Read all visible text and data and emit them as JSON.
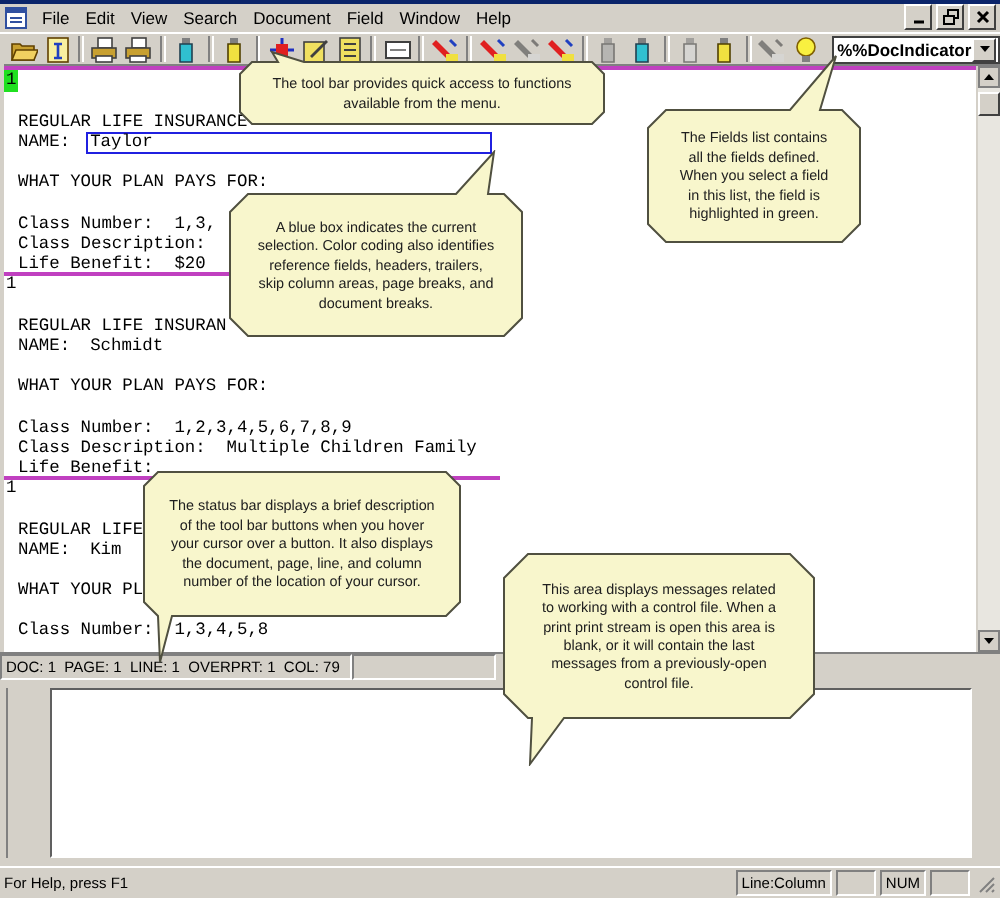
{
  "menu": [
    "File",
    "Edit",
    "View",
    "Search",
    "Document",
    "Field",
    "Window",
    "Help"
  ],
  "toolbar": {
    "buttons": [
      {
        "kind": "folder",
        "disabled": false,
        "separator_before": false
      },
      {
        "kind": "document",
        "disabled": false,
        "separator_before": false
      },
      {
        "kind": "printer",
        "disabled": false,
        "separator_before": true
      },
      {
        "kind": "printer",
        "disabled": false,
        "separator_before": false
      },
      {
        "kind": "flask",
        "disabled": false,
        "separator_before": true
      },
      {
        "kind": "jar",
        "disabled": false,
        "separator_before": true
      },
      {
        "kind": "target",
        "disabled": false,
        "separator_before": true
      },
      {
        "kind": "edit",
        "disabled": false,
        "separator_before": false
      },
      {
        "kind": "list",
        "disabled": false,
        "separator_before": false
      },
      {
        "kind": "box",
        "disabled": false,
        "separator_before": true
      },
      {
        "kind": "marker",
        "disabled": false,
        "separator_before": true
      },
      {
        "kind": "marker",
        "disabled": false,
        "separator_before": true
      },
      {
        "kind": "marker",
        "disabled": true,
        "separator_before": false
      },
      {
        "kind": "marker",
        "disabled": false,
        "separator_before": false
      },
      {
        "kind": "flask",
        "disabled": true,
        "separator_before": true
      },
      {
        "kind": "flask",
        "disabled": false,
        "separator_before": false
      },
      {
        "kind": "jar",
        "disabled": true,
        "separator_before": true
      },
      {
        "kind": "jar",
        "disabled": false,
        "separator_before": false
      },
      {
        "kind": "marker",
        "disabled": true,
        "separator_before": true
      },
      {
        "kind": "bulb",
        "disabled": false,
        "separator_before": false
      }
    ],
    "fields_list": {
      "value": "%%DocIndicator"
    }
  },
  "document": {
    "top_break": true,
    "pages": [
      {
        "marker": "1",
        "highlighted": true,
        "break_after": true,
        "lines": [
          {
            "kind": "blank"
          },
          {
            "kind": "text",
            "text": "REGULAR LIFE INSURANCE"
          },
          {
            "kind": "field",
            "text": "NAME:",
            "field": "Taylor",
            "selected": true
          },
          {
            "kind": "blank"
          },
          {
            "kind": "text",
            "text": "WHAT YOUR PLAN PAYS FOR:"
          },
          {
            "kind": "blank"
          },
          {
            "kind": "text",
            "text": "Class Number:  1,3,"
          },
          {
            "kind": "text",
            "text": "Class Description:"
          },
          {
            "kind": "text",
            "text": "Life Benefit:  $20"
          }
        ]
      },
      {
        "marker": "1",
        "highlighted": false,
        "break_after": true,
        "lines": [
          {
            "kind": "blank"
          },
          {
            "kind": "text",
            "text": "REGULAR LIFE INSURAN"
          },
          {
            "kind": "field",
            "text": "NAME:",
            "field": "Schmidt",
            "selected": false
          },
          {
            "kind": "blank"
          },
          {
            "kind": "text",
            "text": "WHAT YOUR PLAN PAYS FOR:"
          },
          {
            "kind": "blank"
          },
          {
            "kind": "text",
            "text": "Class Number:  1,2,3,4,5,6,7,8,9"
          },
          {
            "kind": "text",
            "text": "Class Description:  Multiple Children Family"
          },
          {
            "kind": "text",
            "text": "Life Benefit:"
          }
        ]
      },
      {
        "marker": "1",
        "highlighted": false,
        "break_after": false,
        "lines": [
          {
            "kind": "blank"
          },
          {
            "kind": "text",
            "text": "REGULAR LIFE"
          },
          {
            "kind": "field",
            "text": "NAME:",
            "field": "Kim",
            "selected": false
          },
          {
            "kind": "blank"
          },
          {
            "kind": "text",
            "text": "WHAT YOUR PL"
          },
          {
            "kind": "blank"
          },
          {
            "kind": "text",
            "text": "Class Number:  1,3,4,5,8"
          }
        ]
      }
    ]
  },
  "document_status": "DOC: 1  PAGE: 1  LINE: 1  OVERPRT: 1  COL: 79",
  "callouts": [
    {
      "text": "The tool bar provides quick access to functions available from the menu."
    },
    {
      "text": "The Fields list contains all the fields defined. When you select a field in this list, the field is highlighted in green."
    },
    {
      "text": "A blue box indicates the current selection. Color coding also identifies reference fields, headers, trailers, skip column areas, page breaks, and document breaks."
    },
    {
      "text": "The status bar displays a brief description of the tool bar buttons when you hover your cursor over a button. It also displays the document, page, line, and column number of the location of your cursor."
    },
    {
      "text": "This area displays messages related to working with a control file. When a print print stream is open this area is blank, or it will contain the last messages from a previously-open control file."
    }
  ],
  "status_bar": {
    "message": "For Help, press F1",
    "panels": [
      "Line:Column",
      "NUM"
    ]
  }
}
